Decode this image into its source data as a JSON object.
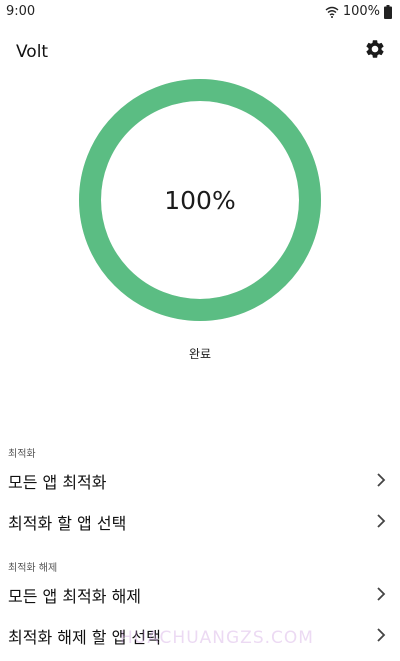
{
  "status_bar": {
    "time": "9:00",
    "battery": "100%",
    "wifi_icon": "wifi-icon",
    "battery_icon": "battery-icon"
  },
  "app_bar": {
    "title": "Volt",
    "settings_icon": "gear-icon"
  },
  "gauge": {
    "value_text": "100%",
    "level": 1.0,
    "color": "#5bbd83"
  },
  "status_label": "완료",
  "sections": [
    {
      "header": "최적화",
      "items": [
        {
          "label": "모든 앱 최적화"
        },
        {
          "label": "최적화 할 앱 선택"
        }
      ]
    },
    {
      "header": "최적화 해제",
      "items": [
        {
          "label": "모든 앱 최적화 해제"
        },
        {
          "label": "최적화 해제 할 앱 선택"
        }
      ]
    }
  ],
  "watermark": "HUACHUANGZS.COM"
}
